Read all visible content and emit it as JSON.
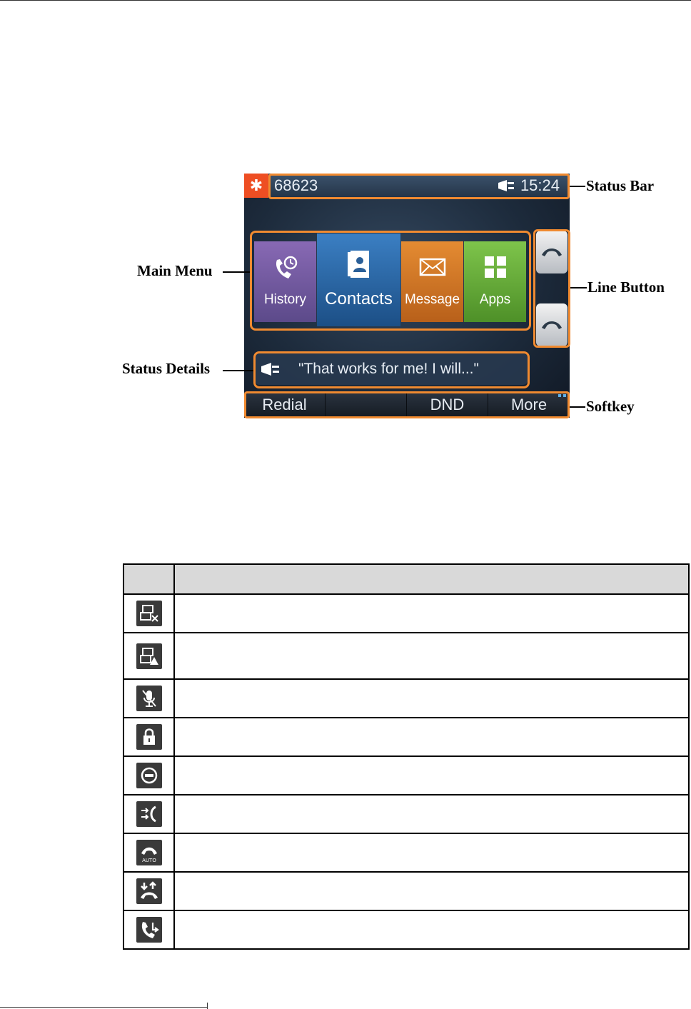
{
  "phone": {
    "status_bar": {
      "number": "68623",
      "time": "15:24"
    },
    "menu": [
      {
        "id": "history",
        "label": "History",
        "icon": "history-icon"
      },
      {
        "id": "contacts",
        "label": "Contacts",
        "icon": "contacts-icon"
      },
      {
        "id": "message",
        "label": "Message",
        "icon": "message-icon"
      },
      {
        "id": "apps",
        "label": "Apps",
        "icon": "apps-icon"
      }
    ],
    "status_detail": "\"That works for me! I will...\"",
    "softkeys": [
      "Redial",
      "",
      "DND",
      "More"
    ]
  },
  "callouts": {
    "status_bar": "Status Bar",
    "line_button": "Line Button",
    "softkey": "Softkey",
    "main_menu": "Main Menu",
    "status_details": "Status Details"
  },
  "icon_table": {
    "header": [
      "",
      ""
    ],
    "rows": [
      {
        "icon": "network-unavailable-icon",
        "text": ""
      },
      {
        "icon": "network-warning-icon",
        "text": ""
      },
      {
        "icon": "mute-icon",
        "text": ""
      },
      {
        "icon": "lock-icon",
        "text": ""
      },
      {
        "icon": "dnd-icon",
        "text": ""
      },
      {
        "icon": "call-forward-icon",
        "text": ""
      },
      {
        "icon": "auto-answer-icon",
        "text": ""
      },
      {
        "icon": "missed-call-icon",
        "text": ""
      },
      {
        "icon": "call-pickup-icon",
        "text": ""
      }
    ]
  },
  "colors": {
    "callout": "#f08a30",
    "logo": "#ee4e23",
    "history": "#8869b4",
    "contacts": "#3b7fc3",
    "message": "#e48b32",
    "apps": "#7ec44b"
  }
}
